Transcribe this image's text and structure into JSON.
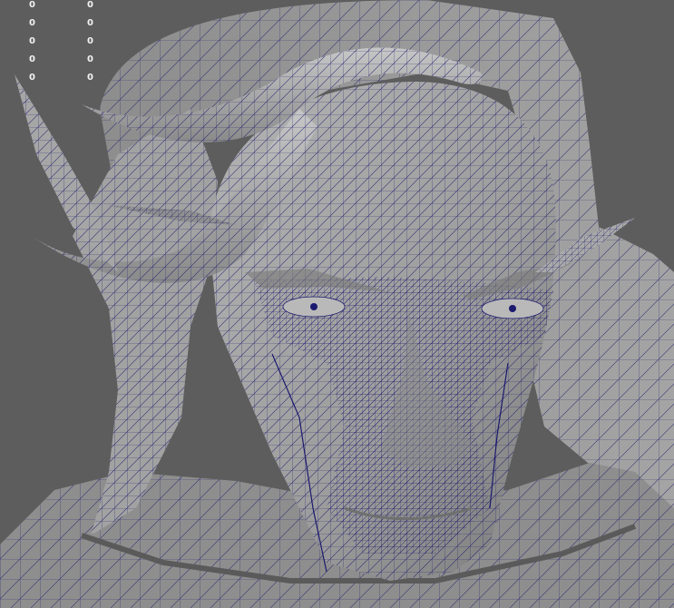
{
  "viewport": {
    "background": "#5d5d5d",
    "mesh_fill": "#9a9a9a",
    "mesh_shade": "#7c7c7c",
    "wire_color": "#1c1a6e",
    "subject": "Wireframe-on-shaded 3D head model with horns and pointed ears"
  },
  "hud_stats": [
    {
      "a": "0",
      "b": "0"
    },
    {
      "a": "0",
      "b": "0"
    },
    {
      "a": "0",
      "b": "0"
    },
    {
      "a": "0",
      "b": "0"
    },
    {
      "a": "0",
      "b": "0"
    }
  ]
}
